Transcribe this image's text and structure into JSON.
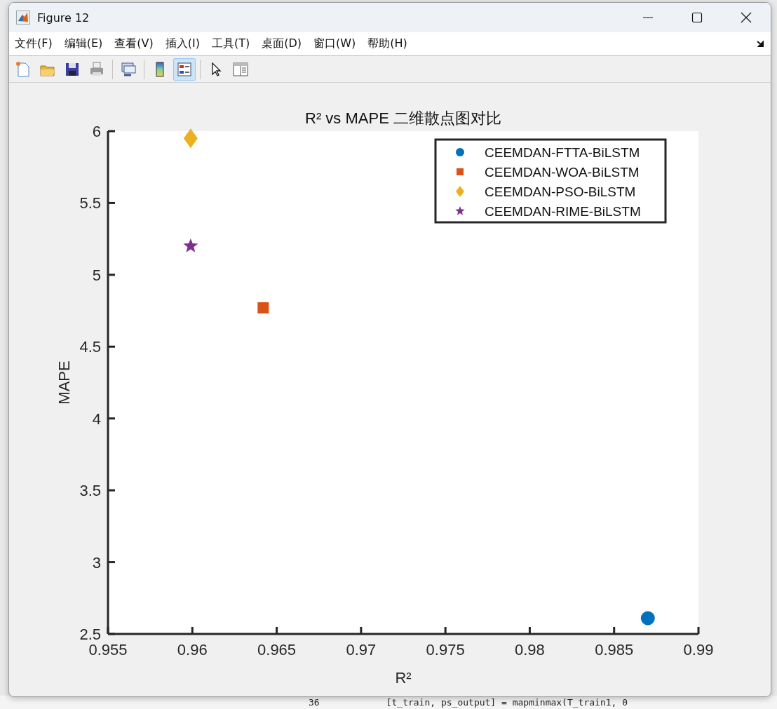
{
  "window": {
    "title": "Figure 12"
  },
  "menu": [
    {
      "label": "文件(F)"
    },
    {
      "label": "编辑(E)"
    },
    {
      "label": "查看(V)"
    },
    {
      "label": "插入(I)"
    },
    {
      "label": "工具(T)"
    },
    {
      "label": "桌面(D)"
    },
    {
      "label": "窗口(W)"
    },
    {
      "label": "帮助(H)"
    }
  ],
  "toolbar": [
    {
      "kind": "new",
      "selected": false
    },
    {
      "kind": "open",
      "selected": false
    },
    {
      "kind": "save",
      "selected": false
    },
    {
      "kind": "print",
      "selected": false
    },
    {
      "kind": "link",
      "selected": false
    },
    {
      "kind": "colorbar",
      "selected": false
    },
    {
      "kind": "legend",
      "selected": true
    },
    {
      "kind": "pointer",
      "selected": false
    },
    {
      "kind": "inspector",
      "selected": false
    }
  ],
  "figure": {
    "chart_data": {
      "type": "scatter",
      "title": "R² vs MAPE 二维散点图对比",
      "xlabel": "R²",
      "ylabel": "MAPE",
      "legend": true,
      "xlim": [
        0.955,
        0.99
      ],
      "ylim": [
        2.5,
        6
      ],
      "xticks": [
        {
          "value": 0.955,
          "label": "0.955"
        },
        {
          "value": 0.96,
          "label": "0.96"
        },
        {
          "value": 0.965,
          "label": "0.965"
        },
        {
          "value": 0.97,
          "label": "0.97"
        },
        {
          "value": 0.975,
          "label": "0.975"
        },
        {
          "value": 0.98,
          "label": "0.98"
        },
        {
          "value": 0.985,
          "label": "0.985"
        },
        {
          "value": 0.99,
          "label": "0.99"
        }
      ],
      "yticks": [
        {
          "value": 2.5,
          "label": "2.5"
        },
        {
          "value": 3,
          "label": "3"
        },
        {
          "value": 3.5,
          "label": "3.5"
        },
        {
          "value": 4,
          "label": "4"
        },
        {
          "value": 4.5,
          "label": "4.5"
        },
        {
          "value": 5,
          "label": "5"
        },
        {
          "value": 5.5,
          "label": "5.5"
        },
        {
          "value": 6,
          "label": "6"
        }
      ],
      "series": [
        {
          "name": "CEEMDAN-FTTA-BiLSTM",
          "color": "#0072bd",
          "marker": "circle",
          "x": [
            0.987
          ],
          "values": [
            2.61
          ]
        },
        {
          "name": "CEEMDAN-WOA-BiLSTM",
          "color": "#d95319",
          "marker": "square",
          "x": [
            0.9642
          ],
          "values": [
            4.77
          ]
        },
        {
          "name": "CEEMDAN-PSO-BiLSTM",
          "color": "#edb120",
          "marker": "diamond",
          "x": [
            0.9599
          ],
          "values": [
            5.95
          ]
        },
        {
          "name": "CEEMDAN-RIME-BiLSTM",
          "color": "#7e2f8e",
          "marker": "star",
          "x": [
            0.9599
          ],
          "values": [
            5.2
          ]
        }
      ]
    }
  },
  "background_editor": {
    "line_number": "36",
    "code": "[t_train, ps_output] = mapminmax(T_train1, 0"
  }
}
